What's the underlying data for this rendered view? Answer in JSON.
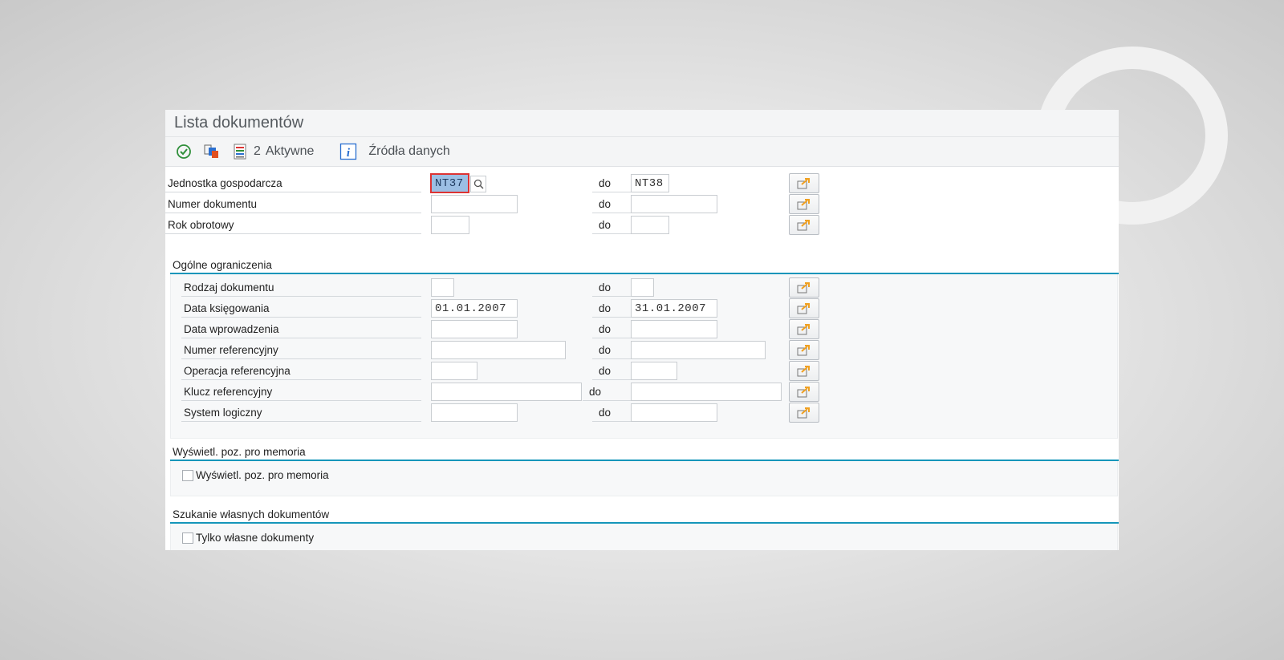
{
  "window": {
    "title": "Lista dokumentów"
  },
  "toolbar": {
    "count": "2",
    "active_label": "Aktywne",
    "datasources_label": "Źródła danych"
  },
  "selection": {
    "do_label": "do",
    "rows": [
      {
        "label": "Jednostka gospodarcza",
        "from": "NT37",
        "to": "NT38"
      },
      {
        "label": "Numer dokumentu",
        "from": "",
        "to": ""
      },
      {
        "label": "Rok obrotowy",
        "from": "",
        "to": ""
      }
    ]
  },
  "general": {
    "title": "Ogólne ograniczenia",
    "rows": [
      {
        "label": "Rodzaj dokumentu",
        "from": "",
        "to": ""
      },
      {
        "label": "Data księgowania",
        "from": "01.01.2007",
        "to": "31.01.2007"
      },
      {
        "label": "Data wprowadzenia",
        "from": "",
        "to": ""
      },
      {
        "label": "Numer referencyjny",
        "from": "",
        "to": ""
      },
      {
        "label": "Operacja referencyjna",
        "from": "",
        "to": ""
      },
      {
        "label": "Klucz referencyjny",
        "from": "",
        "to": ""
      },
      {
        "label": "System logiczny",
        "from": "",
        "to": ""
      }
    ]
  },
  "memo": {
    "title": "Wyświetl. poz. pro memoria",
    "checkbox_label": "Wyświetl. poz. pro memoria",
    "checked": false
  },
  "own_docs": {
    "title": "Szukanie własnych dokumentów",
    "checkbox_label": "Tylko własne dokumenty",
    "checked": false
  },
  "colors": {
    "accent": "#1596ba",
    "focus": "#9cbfe4",
    "focus_border": "#d33333",
    "arrow": "#f0a020"
  }
}
